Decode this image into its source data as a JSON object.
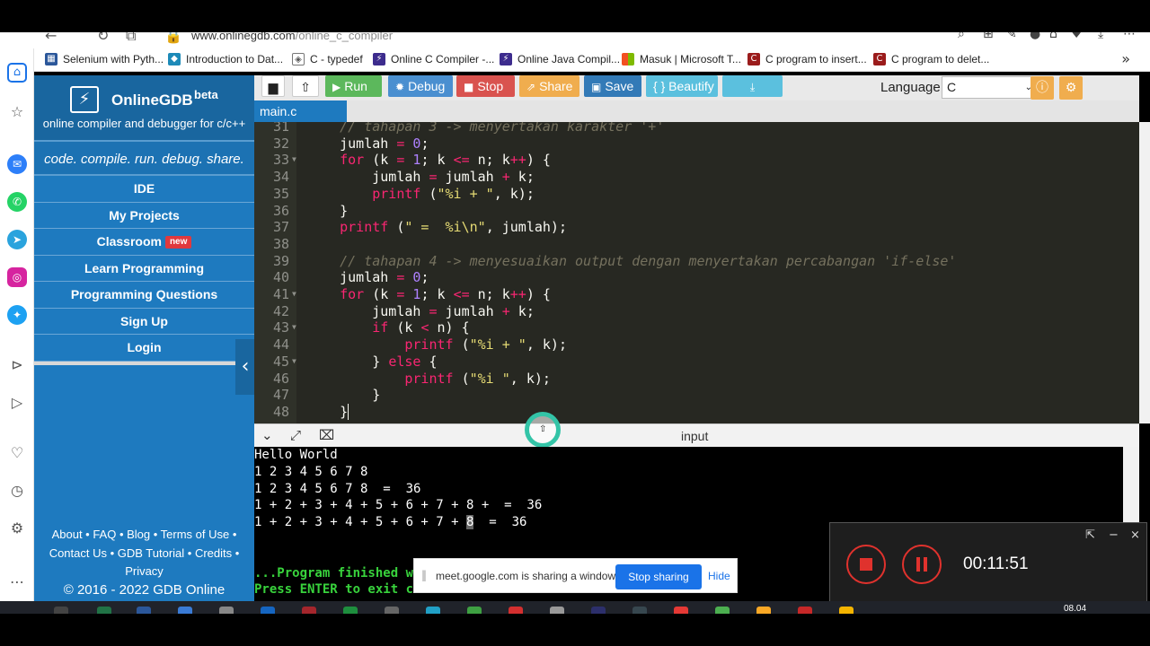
{
  "browser": {
    "url_host": "www.onlinegdb.com",
    "url_path": "/online_c_compiler",
    "bookmarks": [
      {
        "label": "Selenium with Pyth...",
        "color": "#2b579a",
        "icon": "grid-icon"
      },
      {
        "label": "Introduction to Dat...",
        "color": "#1d8ab8",
        "icon": "diamond-icon"
      },
      {
        "label": "C - typedef",
        "color": "#555555",
        "icon": "settings-diamond-icon"
      },
      {
        "label": "Online C Compiler -...",
        "color": "#3d2c8d",
        "icon": "bolt-icon"
      },
      {
        "label": "Online Java Compil...",
        "color": "#3d2c8d",
        "icon": "bolt-icon"
      },
      {
        "label": "Masuk | Microsoft T...",
        "color": "#f25022",
        "icon": "microsoft-icon"
      },
      {
        "label": "C program to insert...",
        "color": "#9b1c1c",
        "icon": "bookmark-red-icon"
      },
      {
        "label": "C program to delet...",
        "color": "#9b1c1c",
        "icon": "bookmark-red-icon"
      }
    ]
  },
  "sidebar": {
    "brand": "OnlineGDB",
    "beta": "beta",
    "tagline": "online compiler and debugger for c/c++",
    "motto": "code. compile. run. debug. share.",
    "menu": [
      {
        "label": "IDE"
      },
      {
        "label": "My Projects"
      },
      {
        "label": "Classroom",
        "badge": "new"
      },
      {
        "label": "Learn Programming"
      },
      {
        "label": "Programming Questions"
      },
      {
        "label": "Sign Up"
      },
      {
        "label": "Login"
      }
    ],
    "footer": {
      "line1": "About • FAQ • Blog • Terms of Use •",
      "line2": "Contact Us • GDB Tutorial • Credits •",
      "line3": "Privacy",
      "copyright": "© 2016 - 2022 GDB Online"
    }
  },
  "toolbar": {
    "run": "Run",
    "debug": "Debug",
    "stop": "Stop",
    "share": "Share",
    "save": "Save",
    "beautify": "{ } Beautify",
    "language_label": "Language",
    "language_value": "C",
    "colors": {
      "run": "#5cb85c",
      "debug": "#4a8fd0",
      "stop": "#d9534f",
      "share": "#f0ad4e",
      "save": "#337ab7",
      "beautify": "#5bc0de",
      "download": "#5bc0de"
    }
  },
  "editor": {
    "tab": "main.c",
    "lines": [
      {
        "n": "31",
        "fold": false,
        "html": "    <span class=\"c-cm\">// tahapan 3 -> menyertakan karakter '+'</span>"
      },
      {
        "n": "32",
        "fold": false,
        "html": "    jumlah <span class=\"c-op\">=</span> <span class=\"c-num\">0</span>;"
      },
      {
        "n": "33",
        "fold": true,
        "html": "    <span class=\"c-kw\">for</span> (k <span class=\"c-op\">=</span> <span class=\"c-num\">1</span>; k <span class=\"c-op\">&lt;=</span> n; k<span class=\"c-op\">++</span>) {"
      },
      {
        "n": "34",
        "fold": false,
        "html": "        jumlah <span class=\"c-op\">=</span> jumlah <span class=\"c-op\">+</span> k;"
      },
      {
        "n": "35",
        "fold": false,
        "html": "        <span class=\"c-fn\">printf</span> (<span class=\"c-str\">\"%i + \"</span>, k);"
      },
      {
        "n": "36",
        "fold": false,
        "html": "    }"
      },
      {
        "n": "37",
        "fold": false,
        "html": "    <span class=\"c-fn\">printf</span> (<span class=\"c-str\">\" =  %i\\n\"</span>, jumlah);"
      },
      {
        "n": "38",
        "fold": false,
        "html": ""
      },
      {
        "n": "39",
        "fold": false,
        "html": "    <span class=\"c-cm\">// tahapan 4 -> menyesuaikan output dengan menyertakan percabangan 'if-else'</span>"
      },
      {
        "n": "40",
        "fold": false,
        "html": "    jumlah <span class=\"c-op\">=</span> <span class=\"c-num\">0</span>;"
      },
      {
        "n": "41",
        "fold": true,
        "html": "    <span class=\"c-kw\">for</span> (k <span class=\"c-op\">=</span> <span class=\"c-num\">1</span>; k <span class=\"c-op\">&lt;=</span> n; k<span class=\"c-op\">++</span>) {"
      },
      {
        "n": "42",
        "fold": false,
        "html": "        jumlah <span class=\"c-op\">=</span> jumlah <span class=\"c-op\">+</span> k;"
      },
      {
        "n": "43",
        "fold": true,
        "html": "        <span class=\"c-kw\">if</span> (k <span class=\"c-op\">&lt;</span> n) {"
      },
      {
        "n": "44",
        "fold": false,
        "html": "            <span class=\"c-fn\">printf</span> (<span class=\"c-str\">\"%i + \"</span>, k);"
      },
      {
        "n": "45",
        "fold": true,
        "html": "        } <span class=\"c-kw\">else</span> {"
      },
      {
        "n": "46",
        "fold": false,
        "html": "            <span class=\"c-fn\">printf</span> (<span class=\"c-str\">\"%i \"</span>, k);"
      },
      {
        "n": "47",
        "fold": false,
        "html": "        }"
      },
      {
        "n": "48",
        "fold": false,
        "html": "    }<span class=\"cursor\"></span>"
      }
    ]
  },
  "io": {
    "label": "input",
    "output": [
      "Hello World",
      "1 2 3 4 5 6 7 8",
      "1 2 3 4 5 6 7 8  =  36",
      "1 + 2 + 3 + 4 + 5 + 6 + 7 + 8 +  =  36"
    ],
    "last_line_prefix": "1 + 2 + 3 + 4 + 5 + 6 + 7 + ",
    "last_line_highlight": "8",
    "last_line_suffix": "  =  36",
    "finished": "...Program finished w",
    "press_enter": "Press ENTER to exit c"
  },
  "meet": {
    "message": "meet.google.com is sharing a window.",
    "stop": "Stop sharing",
    "hide": "Hide"
  },
  "recorder": {
    "time": "00:11:51"
  },
  "taskbar": {
    "clock": "08.04"
  }
}
